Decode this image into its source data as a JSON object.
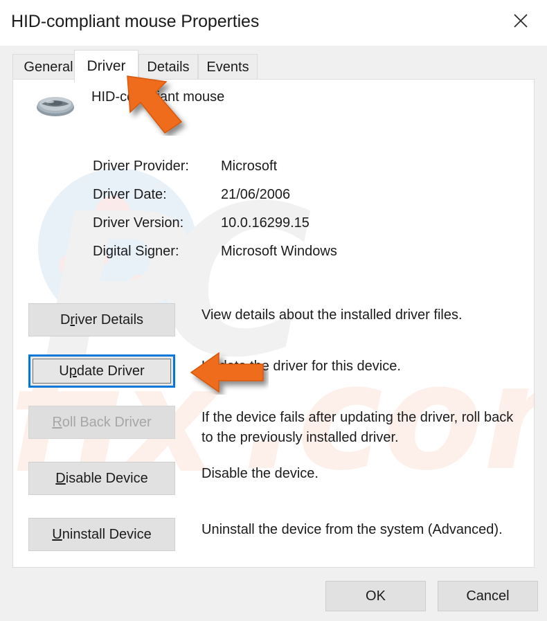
{
  "window": {
    "title": "HID-compliant mouse Properties",
    "close_icon": "close-icon"
  },
  "tabs": [
    {
      "label": "General",
      "active": false
    },
    {
      "label": "Driver",
      "active": true
    },
    {
      "label": "Details",
      "active": false
    },
    {
      "label": "Events",
      "active": false
    }
  ],
  "device": {
    "icon": "mouse-icon",
    "name": "HID-compliant mouse"
  },
  "driver_info": [
    {
      "label": "Driver Provider:",
      "value": "Microsoft"
    },
    {
      "label": "Driver Date:",
      "value": "21/06/2006"
    },
    {
      "label": "Driver Version:",
      "value": "10.0.16299.15"
    },
    {
      "label": "Digital Signer:",
      "value": "Microsoft Windows"
    }
  ],
  "actions": [
    {
      "label": "Driver Details",
      "access_key": "r",
      "description": "View details about the installed driver files.",
      "disabled": false,
      "focused": false
    },
    {
      "label": "Update Driver",
      "access_key": "p",
      "description": "Update the driver for this device.",
      "disabled": false,
      "focused": true
    },
    {
      "label": "Roll Back Driver",
      "access_key": "R",
      "description": "If the device fails after updating the driver, roll back to the previously installed driver.",
      "disabled": true,
      "focused": false
    },
    {
      "label": "Disable Device",
      "access_key": "D",
      "description": "Disable the device.",
      "disabled": false,
      "focused": false
    },
    {
      "label": "Uninstall Device",
      "access_key": "U",
      "description": "Uninstall the device from the system (Advanced).",
      "disabled": false,
      "focused": false
    }
  ],
  "footer": {
    "ok_label": "OK",
    "cancel_label": "Cancel"
  },
  "annotations": [
    {
      "name": "arrow-pointing-driver-tab",
      "direction": "up-left",
      "color": "#ef6c1f"
    },
    {
      "name": "arrow-pointing-update-driver-button",
      "direction": "left",
      "color": "#ef6c1f"
    }
  ],
  "colors": {
    "accent": "#0078d7",
    "annotation": "#ef6c1f",
    "dialog_bg": "#f0f0f0",
    "panel_bg": "#ffffff",
    "button_bg": "#e1e1e1",
    "text": "#1b1b1b",
    "disabled_text": "#a6a6a6"
  }
}
